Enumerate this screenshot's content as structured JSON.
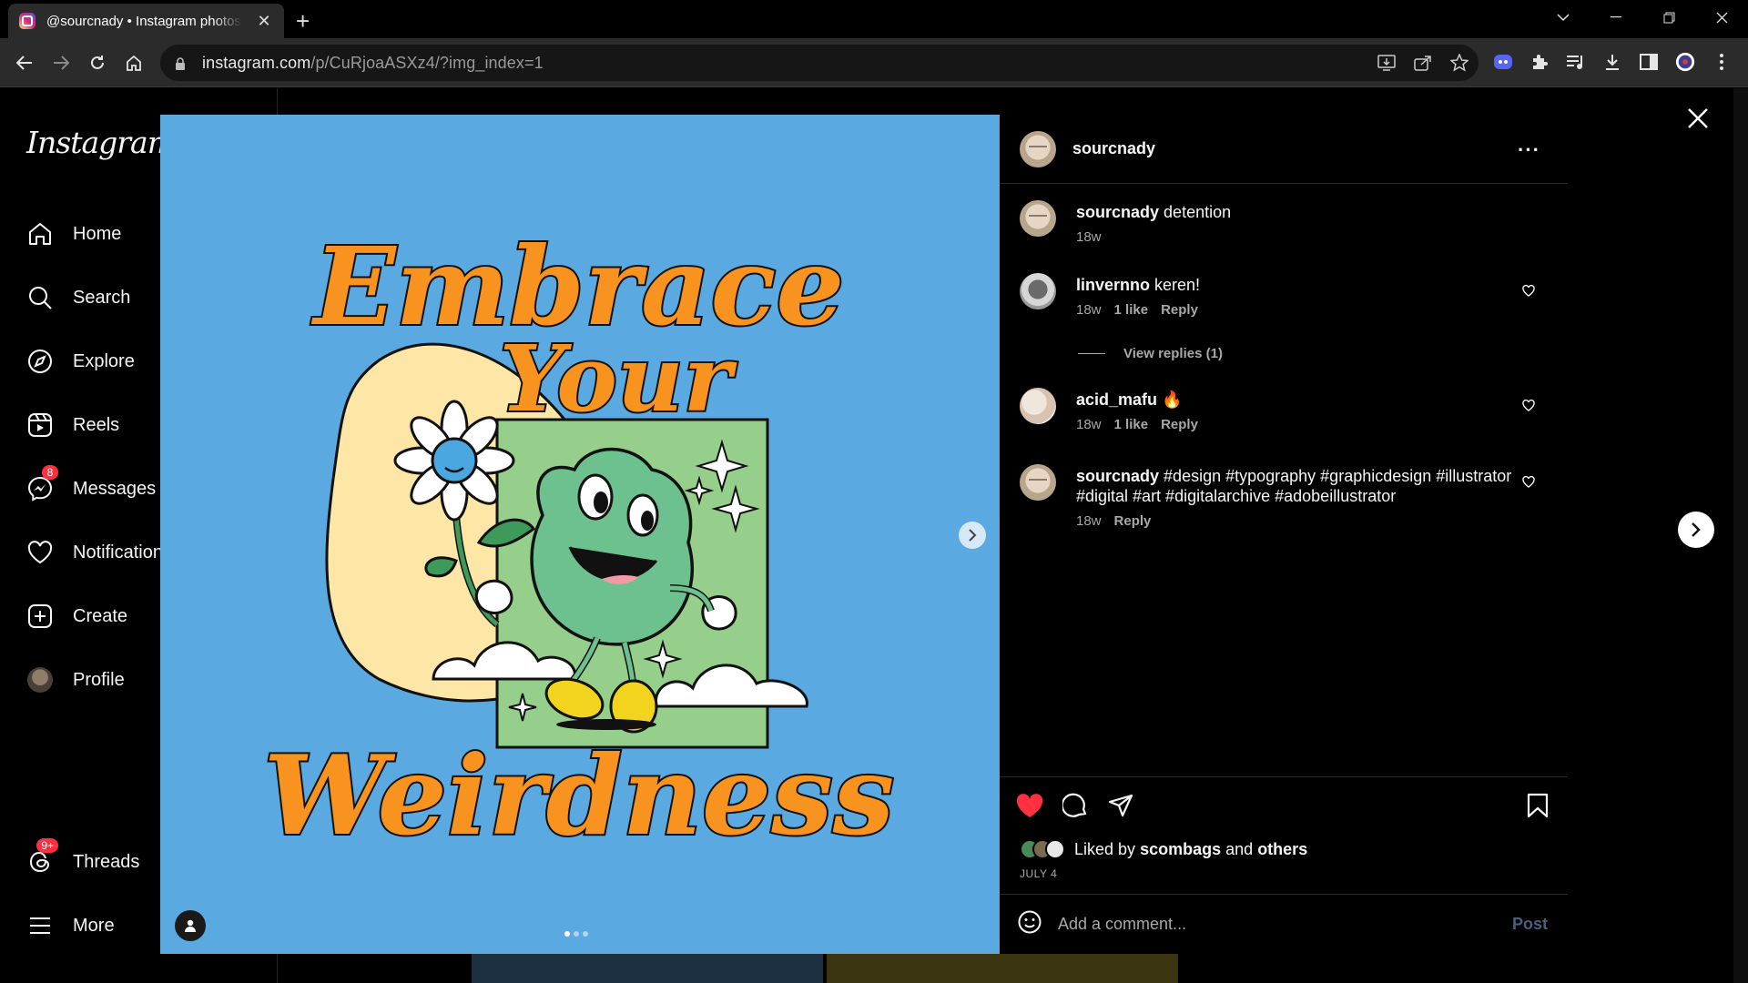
{
  "browser": {
    "tab_title": "@sourcnady • Instagram photos and videos",
    "url_host": "instagram.com",
    "url_path": "/p/CuRjoaASXz4/?img_index=1"
  },
  "sidebar": {
    "logo": "Instagram",
    "items": [
      {
        "label": "Home",
        "icon": "home-icon"
      },
      {
        "label": "Search",
        "icon": "search-icon"
      },
      {
        "label": "Explore",
        "icon": "compass-icon"
      },
      {
        "label": "Reels",
        "icon": "reels-icon"
      },
      {
        "label": "Messages",
        "icon": "messenger-icon",
        "badge": "8"
      },
      {
        "label": "Notifications",
        "icon": "heart-icon"
      },
      {
        "label": "Create",
        "icon": "plus-square-icon"
      },
      {
        "label": "Profile",
        "icon": "avatar"
      },
      {
        "label": "Threads",
        "icon": "threads-icon",
        "badge": "9+"
      },
      {
        "label": "More",
        "icon": "hamburger-icon"
      }
    ]
  },
  "post": {
    "author": "sourcnady",
    "comments": [
      {
        "user": "sourcnady",
        "text": "detention",
        "time": "18w"
      },
      {
        "user": "linvernno",
        "text": "keren!",
        "time": "18w",
        "likes": "1 like",
        "reply": "Reply",
        "view_replies": "View replies (1)"
      },
      {
        "user": "acid_mafu",
        "text": "🔥",
        "time": "18w",
        "likes": "1 like",
        "reply": "Reply"
      },
      {
        "user": "sourcnady",
        "text": "#design #typography #graphicdesign #illustrator #digital #art #digitalarchive #adobeillustrator",
        "time": "18w",
        "reply": "Reply"
      }
    ],
    "liked_by_prefix": "Liked by",
    "liked_by_user": "scombags",
    "liked_by_and": "and",
    "liked_by_others": "others",
    "date": "JULY 4",
    "comment_placeholder": "Add a comment...",
    "post_button": "Post"
  },
  "colors": {
    "media_bg": "#5aa9e0",
    "liked_heart": "#ff3040",
    "accent_orange": "#f7931e"
  }
}
